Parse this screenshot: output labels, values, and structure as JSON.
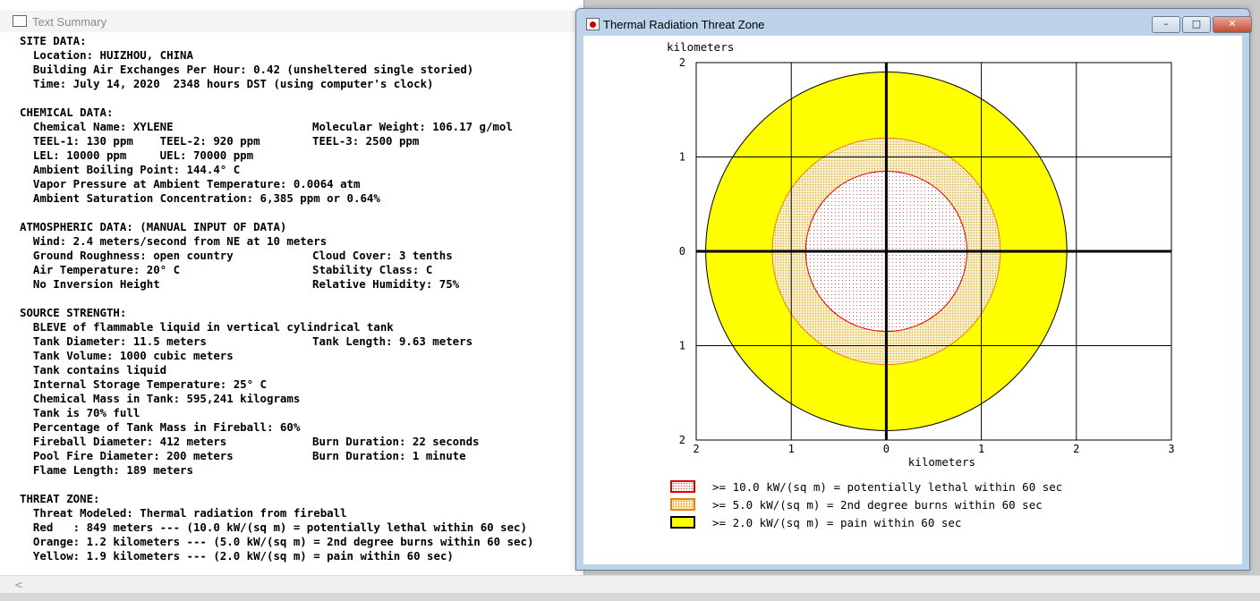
{
  "text_window": {
    "title": "Text Summary",
    "icon": "notepad-icon",
    "lines": [
      {
        "text": "SITE DATA:"
      },
      {
        "text": "  Location: HUIZHOU, CHINA"
      },
      {
        "text": "  Building Air Exchanges Per Hour: 0.42 (unsheltered single storied)"
      },
      {
        "text": "  Time: July 14, 2020  2348 hours DST (using computer's clock)"
      },
      {
        "text": ""
      },
      {
        "text": "CHEMICAL DATA:"
      },
      {
        "text": "  Chemical Name: XYLENE",
        "col2": "Molecular Weight: 106.17 g/mol"
      },
      {
        "text": "  TEEL-1: 130 ppm    TEEL-2: 920 ppm",
        "col2": "TEEL-3: 2500 ppm"
      },
      {
        "text": "  LEL: 10000 ppm     UEL: 70000 ppm"
      },
      {
        "text": "  Ambient Boiling Point: 144.4° C"
      },
      {
        "text": "  Vapor Pressure at Ambient Temperature: 0.0064 atm"
      },
      {
        "text": "  Ambient Saturation Concentration: 6,385 ppm or 0.64%"
      },
      {
        "text": ""
      },
      {
        "text": "ATMOSPHERIC DATA: (MANUAL INPUT OF DATA)"
      },
      {
        "text": "  Wind: 2.4 meters/second from NE at 10 meters"
      },
      {
        "text": "  Ground Roughness: open country",
        "col2": "Cloud Cover: 3 tenths"
      },
      {
        "text": "  Air Temperature: 20° C",
        "col2": "Stability Class: C"
      },
      {
        "text": "  No Inversion Height",
        "col2": "Relative Humidity: 75%"
      },
      {
        "text": ""
      },
      {
        "text": "SOURCE STRENGTH:"
      },
      {
        "text": "  BLEVE of flammable liquid in vertical cylindrical tank"
      },
      {
        "text": "  Tank Diameter: 11.5 meters",
        "col2": "Tank Length: 9.63 meters"
      },
      {
        "text": "  Tank Volume: 1000 cubic meters"
      },
      {
        "text": "  Tank contains liquid"
      },
      {
        "text": "  Internal Storage Temperature: 25° C"
      },
      {
        "text": "  Chemical Mass in Tank: 595,241 kilograms"
      },
      {
        "text": "  Tank is 70% full"
      },
      {
        "text": "  Percentage of Tank Mass in Fireball: 60%"
      },
      {
        "text": "  Fireball Diameter: 412 meters",
        "col2": "Burn Duration: 22 seconds"
      },
      {
        "text": "  Pool Fire Diameter: 200 meters",
        "col2": "Burn Duration: 1 minute"
      },
      {
        "text": "  Flame Length: 189 meters"
      },
      {
        "text": ""
      },
      {
        "text": "THREAT ZONE:"
      },
      {
        "text": "  Threat Modeled: Thermal radiation from fireball"
      },
      {
        "text": "  Red   : 849 meters --- (10.0 kW/(sq m) = potentially lethal within 60 sec)"
      },
      {
        "text": "  Orange: 1.2 kilometers --- (5.0 kW/(sq m) = 2nd degree burns within 60 sec)"
      },
      {
        "text": "  Yellow: 1.9 kilometers --- (2.0 kW/(sq m) = pain within 60 sec)"
      }
    ]
  },
  "threat_window": {
    "title": "Thermal Radiation Threat Zone",
    "icon": "red-dot-icon",
    "buttons": {
      "minimize": "minimize-icon",
      "maximize": "maximize-icon",
      "close": "close-icon"
    },
    "legend": [
      {
        "color": "#ffffff",
        "border": "#e00000",
        "pattern": "red-dots",
        "text": ">= 10.0 kW/(sq m) = potentially lethal within 60 sec"
      },
      {
        "color": "#f5e6b8",
        "border": "#f08000",
        "pattern": "orange-dots",
        "text": ">= 5.0 kW/(sq m) = 2nd degree burns within 60 sec"
      },
      {
        "color": "#ffff00",
        "border": "#000000",
        "pattern": "solid",
        "text": ">= 2.0 kW/(sq m) = pain within 60 sec"
      }
    ]
  },
  "chart_data": {
    "type": "threat-zone-plot",
    "ylabel": "kilometers",
    "xlabel": "kilometers",
    "x_ticks": [
      "2",
      "1",
      "0",
      "1",
      "2",
      "3"
    ],
    "y_ticks": [
      "2",
      "1",
      "0",
      "1",
      "2"
    ],
    "x_range_km": [
      -2,
      3
    ],
    "y_range_km": [
      -2,
      2
    ],
    "grid": true,
    "zones": [
      {
        "name": "Yellow",
        "radius_km": 1.9,
        "fill": "#ffff00",
        "stroke": "#000000"
      },
      {
        "name": "Orange",
        "radius_km": 1.2,
        "fill": "#f5e6b8",
        "stroke": "#f08000"
      },
      {
        "name": "Red",
        "radius_km": 0.849,
        "fill": "#ffffff",
        "stroke": "#e00000"
      }
    ]
  }
}
